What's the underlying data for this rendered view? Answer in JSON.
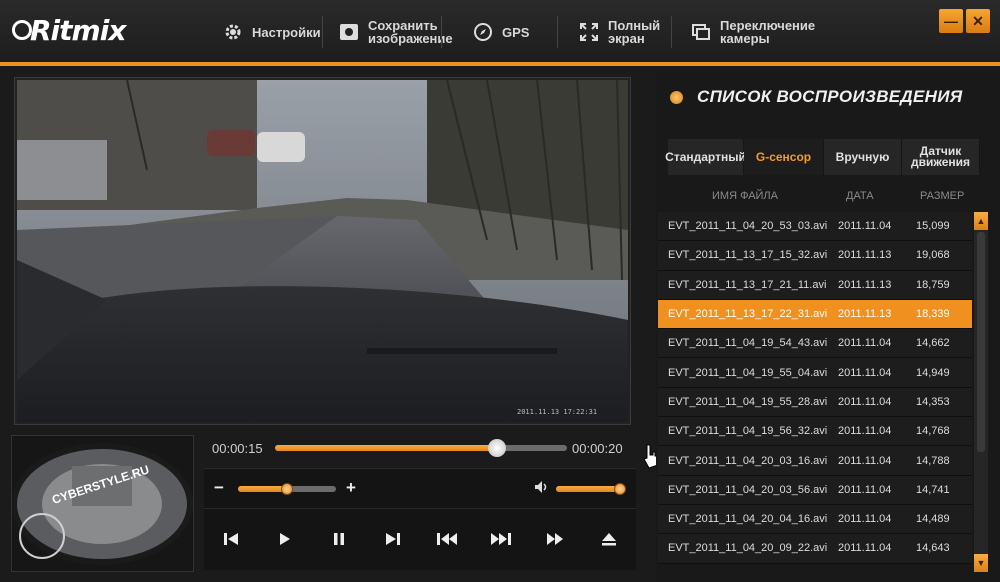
{
  "app": {
    "logo_text": "Ritmix"
  },
  "toolbar": {
    "settings_label": "Настройки",
    "save_label_1": "Сохранить",
    "save_label_2": "изображение",
    "gps_label": "GPS",
    "fullscreen_label_1": "Полный",
    "fullscreen_label_2": "экран",
    "switch_label_1": "Переключение",
    "switch_label_2": "камеры"
  },
  "window": {
    "minimize": "—",
    "close": "✕"
  },
  "video": {
    "overlay_text": "2011.11.13  17:22:31"
  },
  "thumbnail": {
    "watermark": "CYBERSTYLE.RU"
  },
  "player": {
    "current_time": "00:00:15",
    "total_time": "00:00:20",
    "progress_fraction": 0.76,
    "zoom_fraction": 0.5,
    "volume_fraction": 0.92,
    "minus": "−",
    "plus": "+"
  },
  "playlist": {
    "title": "СПИСОК ВОСПРОИЗВЕДЕНИЯ",
    "tabs": [
      {
        "label": "Стандартный",
        "active": false
      },
      {
        "label": "G-сенсор",
        "active": true
      },
      {
        "label": "Вручную",
        "active": false
      },
      {
        "label_1": "Датчик",
        "label_2": "движения",
        "active": false
      }
    ],
    "columns": {
      "name": "ИМЯ ФАЙЛА",
      "date": "ДАТА",
      "size": "РАЗМЕР"
    },
    "rows": [
      {
        "name": "EVT_2011_11_04_20_53_03.avi",
        "date": "2011.11.04",
        "size": "15,099"
      },
      {
        "name": "EVT_2011_11_13_17_15_32.avi",
        "date": "2011.11.13",
        "size": "19,068"
      },
      {
        "name": "EVT_2011_11_13_17_21_11.avi",
        "date": "2011.11.13",
        "size": "18,759"
      },
      {
        "name": "EVT_2011_11_13_17_22_31.avi",
        "date": "2011.11.13",
        "size": "18,339",
        "selected": true
      },
      {
        "name": "EVT_2011_11_04_19_54_43.avi",
        "date": "2011.11.04",
        "size": "14,662"
      },
      {
        "name": "EVT_2011_11_04_19_55_04.avi",
        "date": "2011.11.04",
        "size": "14,949"
      },
      {
        "name": "EVT_2011_11_04_19_55_28.avi",
        "date": "2011.11.04",
        "size": "14,353"
      },
      {
        "name": "EVT_2011_11_04_19_56_32.avi",
        "date": "2011.11.04",
        "size": "14,768"
      },
      {
        "name": "EVT_2011_11_04_20_03_16.avi",
        "date": "2011.11.04",
        "size": "14,788"
      },
      {
        "name": "EVT_2011_11_04_20_03_56.avi",
        "date": "2011.11.04",
        "size": "14,741"
      },
      {
        "name": "EVT_2011_11_04_20_04_16.avi",
        "date": "2011.11.04",
        "size": "14,489"
      },
      {
        "name": "EVT_2011_11_04_20_09_22.avi",
        "date": "2011.11.04",
        "size": "14,643"
      }
    ]
  },
  "colors": {
    "accent": "#f0901e",
    "background": "#1b1b1b"
  }
}
